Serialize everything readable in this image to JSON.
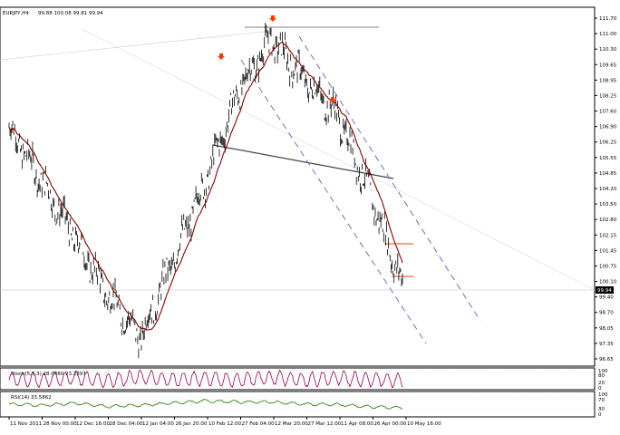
{
  "header": {
    "symbol_label": "EURJPY,H4",
    "ohlc_label": "99.88 100.08 99.81 99.94"
  },
  "price_axis": {
    "labels": [
      "111.70",
      "111.00",
      "110.30",
      "109.65",
      "108.95",
      "108.25",
      "107.60",
      "106.90",
      "106.25",
      "105.55",
      "104.85",
      "104.20",
      "103.50",
      "102.80",
      "102.15",
      "101.45",
      "100.75",
      "100.10",
      "99.40",
      "98.70",
      "98.05",
      "97.35",
      "96.65"
    ],
    "current_price_label": "99.94"
  },
  "stoch_panel": {
    "label": "Stoch(5,3,3) 28.0480 23.2397",
    "axis_labels": [
      "100",
      "80",
      "20",
      "0"
    ]
  },
  "rsi_panel": {
    "label": "RSI(14) 33.5862",
    "axis_labels": [
      "100",
      "70",
      "30",
      "0"
    ]
  },
  "time_axis": {
    "labels": [
      "11 Nov 2011",
      "28 Nov 00:00",
      "12 Dec 16:00",
      "28 Dec 04:00",
      "12 Jan 04:00",
      "26 Jan 20:00",
      "10 Feb 12:00",
      "27 Feb 04:00",
      "12 Mar 20:00",
      "27 Mar 12:00",
      "11 Apr 08:00",
      "26 Apr 00:00",
      "10 May 16:00"
    ]
  },
  "colors": {
    "candles": "#000000",
    "moving_average": "#8b0000",
    "channel_lines": "#7070c8",
    "neckline": "#444444",
    "arrows": "#ff3b00",
    "stoch_line": "#9b0060",
    "rsi_line": "#2a7a00"
  },
  "chart_data": [
    {
      "type": "line",
      "x": [
        "11 Nov 2011",
        "28 Nov 00:00",
        "12 Dec 16:00",
        "28 Dec 04:00",
        "12 Jan 04:00",
        "26 Jan 20:00",
        "10 Feb 12:00",
        "27 Feb 04:00",
        "12 Mar 20:00",
        "27 Mar 12:00",
        "11 Apr 08:00",
        "26 Apr 00:00",
        "10 May 16:00"
      ],
      "series": [
        {
          "values": [
            106.9,
            104.5,
            102.0,
            99.5,
            97.6,
            101.0,
            104.5,
            108.5,
            110.8,
            109.0,
            107.5,
            104.0,
            99.9
          ]
        }
      ],
      "ylim": [
        96.65,
        111.7
      ]
    },
    {
      "type": "line",
      "series": [
        {
          "values": [
            45,
            30,
            70,
            20,
            80,
            35,
            60,
            25,
            75,
            30,
            65,
            40,
            28
          ]
        }
      ],
      "ylim": [
        0,
        100
      ]
    },
    {
      "type": "line",
      "series": [
        {
          "values": [
            50,
            45,
            55,
            40,
            45,
            55,
            65,
            60,
            60,
            50,
            48,
            38,
            34
          ]
        }
      ],
      "ylim": [
        0,
        100
      ]
    }
  ]
}
